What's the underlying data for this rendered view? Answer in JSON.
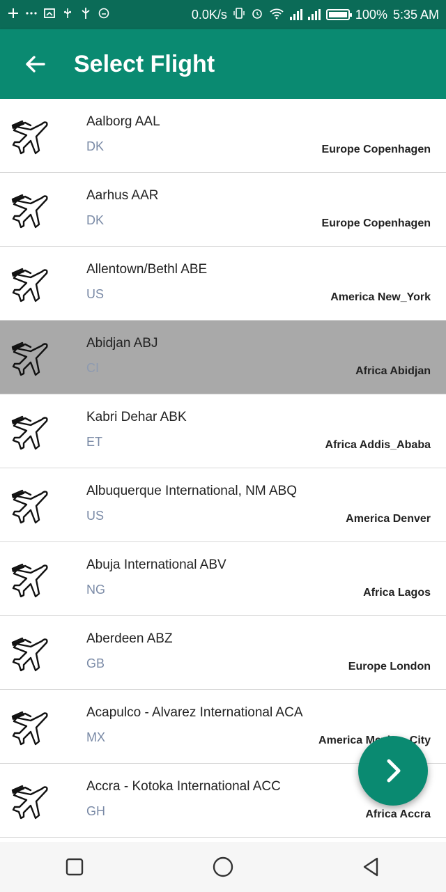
{
  "status_bar": {
    "left_icons": [
      "plus-icon",
      "more-icon",
      "screenshot-icon",
      "usb-icon",
      "usb-debug-icon",
      "notification-icon"
    ],
    "net_speed": "0.0K/s",
    "battery": "100%",
    "time": "5:35 AM"
  },
  "header": {
    "title": "Select Flight"
  },
  "flights": [
    {
      "name": "Aalborg AAL",
      "code": "DK",
      "timezone": "Europe Copenhagen",
      "selected": false
    },
    {
      "name": "Aarhus AAR",
      "code": "DK",
      "timezone": "Europe Copenhagen",
      "selected": false
    },
    {
      "name": "Allentown/Bethl ABE",
      "code": "US",
      "timezone": "America New_York",
      "selected": false
    },
    {
      "name": "Abidjan ABJ",
      "code": "CI",
      "timezone": "Africa Abidjan",
      "selected": true
    },
    {
      "name": "Kabri Dehar ABK",
      "code": "ET",
      "timezone": "Africa Addis_Ababa",
      "selected": false
    },
    {
      "name": "Albuquerque International, NM ABQ",
      "code": "US",
      "timezone": "America Denver",
      "selected": false
    },
    {
      "name": "Abuja International ABV",
      "code": "NG",
      "timezone": "Africa Lagos",
      "selected": false
    },
    {
      "name": "Aberdeen ABZ",
      "code": "GB",
      "timezone": "Europe London",
      "selected": false
    },
    {
      "name": "Acapulco - Alvarez International ACA",
      "code": "MX",
      "timezone": "America Mexico_City",
      "selected": false
    },
    {
      "name": "Accra - Kotoka International ACC",
      "code": "GH",
      "timezone": "Africa Accra",
      "selected": false
    }
  ],
  "colors": {
    "primary": "#0a8a71",
    "status_bar": "#0b6b57",
    "selected_row": "#a9a9a9",
    "code_text": "#7a8aa6"
  }
}
